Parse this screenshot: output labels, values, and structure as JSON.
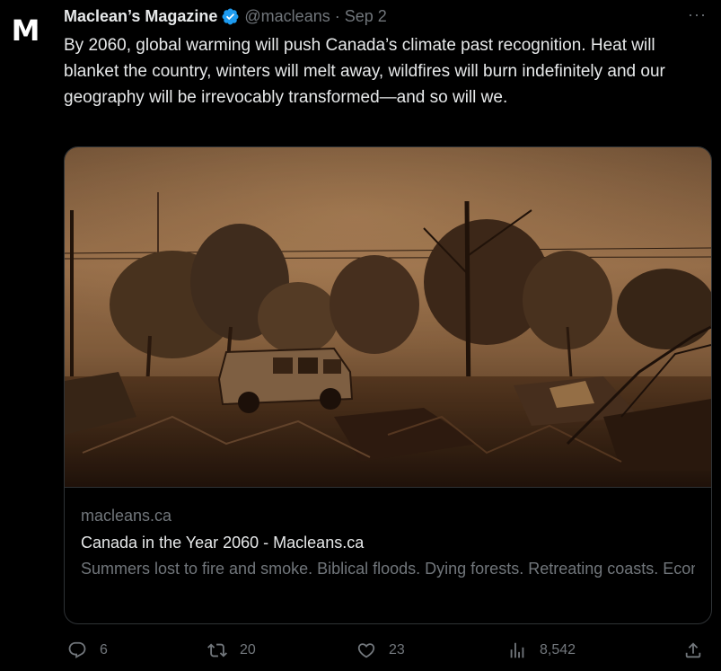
{
  "avatar": {
    "letter": "M"
  },
  "tweet": {
    "display_name": "Maclean’s Magazine",
    "verified_icon": "verified-badge-icon",
    "handle": "@macleans",
    "separator": "·",
    "date": "Sep 2",
    "more_icon": "more-icon",
    "more_label": "···",
    "text": "By 2060, global warming will push Canada’s climate past recognition. Heat will blanket the country, winters will melt away, wildfires will burn indefinitely and our geography will be irrevocably transformed—and so will we."
  },
  "card": {
    "image_subject": "burned-out van and scorched trees after a wildfire",
    "domain": "macleans.ca",
    "title": "Canada in the Year 2060 - Macleans.ca",
    "description": "Summers lost to fire and smoke. Biblical floods. Dying forests. Retreating coasts. Economic turmoil and political unrest. It’s going to ..."
  },
  "actions": {
    "reply": {
      "icon": "reply-icon",
      "count": "6"
    },
    "retweet": {
      "icon": "retweet-icon",
      "count": "20"
    },
    "like": {
      "icon": "heart-icon",
      "count": "23"
    },
    "views": {
      "icon": "views-icon",
      "count": "8,542"
    },
    "share": {
      "icon": "share-icon"
    }
  },
  "colors": {
    "background": "#000000",
    "text_primary": "#e7e9ea",
    "text_secondary": "#71767b",
    "verified_blue": "#1d9bf0",
    "border": "#2f3336"
  }
}
